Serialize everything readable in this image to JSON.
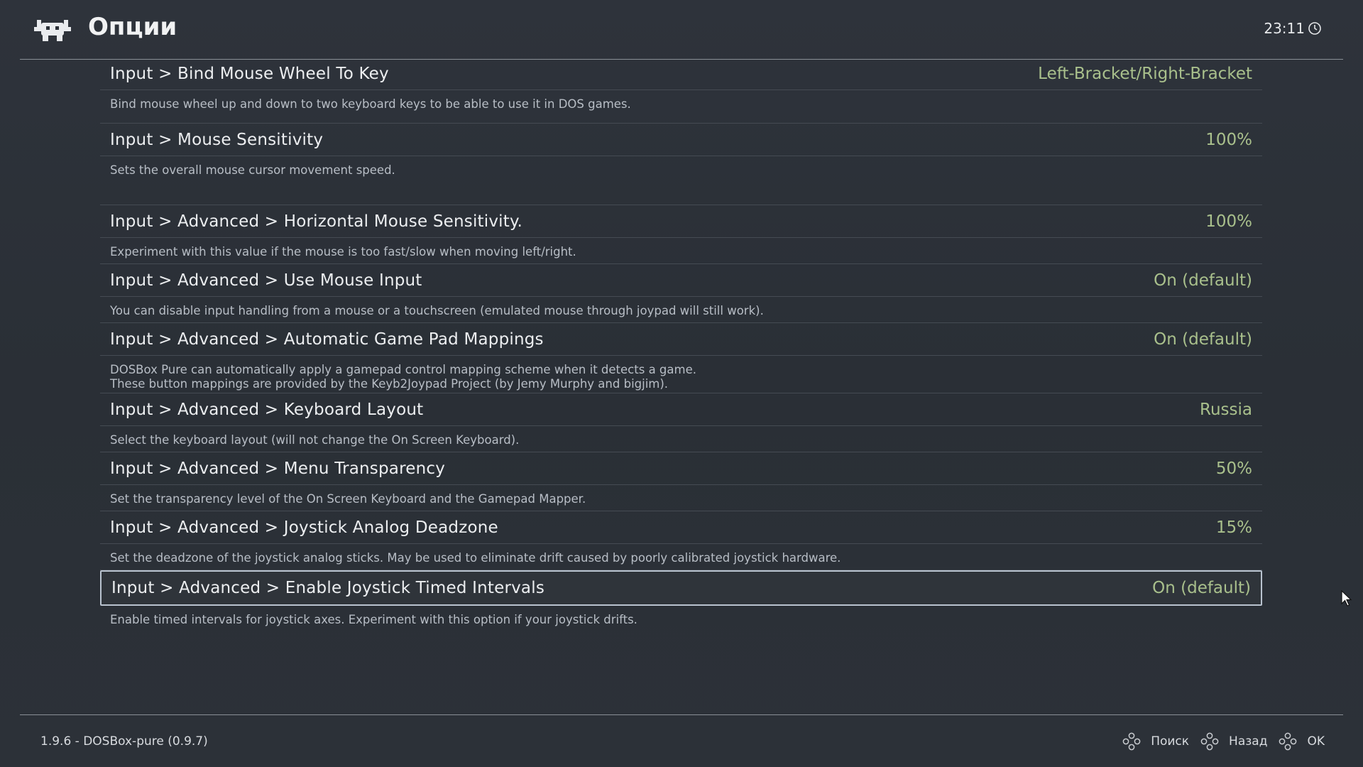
{
  "header": {
    "title": "Опции",
    "clock": "23:11",
    "logo_icon": "retroarch-invader-logo",
    "clock_icon": "clock-icon"
  },
  "entries": [
    {
      "label": "Input > Bind Mouse Wheel To Key",
      "value": "Left-Bracket/Right-Bracket",
      "description": [
        "Bind mouse wheel up and down to two keyboard keys to be able to use it in DOS games."
      ]
    },
    {
      "label": "Input > Mouse Sensitivity",
      "value": "100%",
      "description": [
        "Sets the overall mouse cursor movement speed."
      ]
    },
    {
      "label": "Input > Advanced > Horizontal Mouse Sensitivity.",
      "value": "100%",
      "description": [
        "Experiment with this value if the mouse is too fast/slow when moving left/right."
      ]
    },
    {
      "label": "Input > Advanced > Use Mouse Input",
      "value": "On (default)",
      "description": [
        "You can disable input handling from a mouse or a touchscreen (emulated mouse through joypad will still work)."
      ]
    },
    {
      "label": "Input > Advanced > Automatic Game Pad Mappings",
      "value": "On (default)",
      "description": [
        "DOSBox Pure can automatically apply a gamepad control mapping scheme when it detects a game.",
        "These button mappings are provided by the Keyb2Joypad Project (by Jemy Murphy and bigjim)."
      ]
    },
    {
      "label": "Input > Advanced > Keyboard Layout",
      "value": "Russia",
      "description": [
        "Select the keyboard layout (will not change the On Screen Keyboard)."
      ]
    },
    {
      "label": "Input > Advanced > Menu Transparency",
      "value": "50%",
      "description": [
        "Set the transparency level of the On Screen Keyboard and the Gamepad Mapper."
      ]
    },
    {
      "label": "Input > Advanced > Joystick Analog Deadzone",
      "value": "15%",
      "description": [
        "Set the deadzone of the joystick analog sticks. May be used to eliminate drift caused by poorly calibrated joystick hardware."
      ]
    },
    {
      "label": "Input > Advanced > Enable Joystick Timed Intervals",
      "value": "On (default)",
      "description": [
        "Enable timed intervals for joystick axes. Experiment with this option if your joystick drifts."
      ],
      "selected": true
    }
  ],
  "footer": {
    "version": "1.9.6 - DOSBox-pure (0.9.7)",
    "actions": [
      {
        "label": "Поиск",
        "icon": "gamepad-buttons-icon"
      },
      {
        "label": "Назад",
        "icon": "gamepad-buttons-icon"
      },
      {
        "label": "OK",
        "icon": "gamepad-buttons-icon"
      }
    ]
  },
  "colors": {
    "background": "#2b3038",
    "value_text": "#a9c08c",
    "selection_border": "#b9c3cf"
  }
}
